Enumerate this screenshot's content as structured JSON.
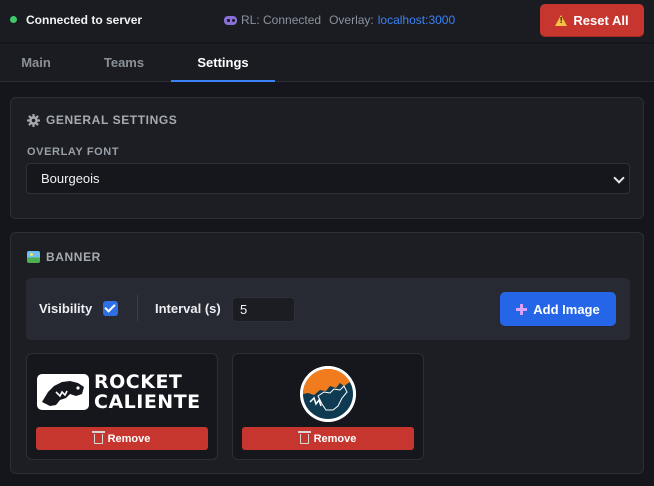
{
  "header": {
    "connection_status": "Connected to server",
    "rl_status": "RL: Connected",
    "overlay_label": "Overlay:",
    "overlay_url": "localhost:3000",
    "reset_label": "Reset All"
  },
  "tabs": [
    {
      "label": "Main",
      "active": false
    },
    {
      "label": "Teams",
      "active": false
    },
    {
      "label": "Settings",
      "active": true
    }
  ],
  "general": {
    "title": "GENERAL SETTINGS",
    "font_label": "OVERLAY FONT",
    "font_value": "Bourgeois"
  },
  "banner": {
    "title": "BANNER",
    "visibility_label": "Visibility",
    "visibility_checked": true,
    "interval_label": "Interval (s)",
    "interval_value": "5",
    "add_label": "Add Image",
    "images": [
      {
        "logo_text_line1": "ROCKET",
        "logo_text_line2": "CALIENTE",
        "remove_label": "Remove"
      },
      {
        "remove_label": "Remove"
      }
    ]
  },
  "colors": {
    "accent": "#3b82f6",
    "danger": "#c6362f",
    "primary_button": "#2566e8",
    "status_ok": "#3fc86a"
  },
  "icons": [
    "status-dot-icon",
    "gamepad-icon",
    "warning-icon",
    "gear-icon",
    "image-icon",
    "plus-icon",
    "trash-icon",
    "chevron-down-icon"
  ]
}
